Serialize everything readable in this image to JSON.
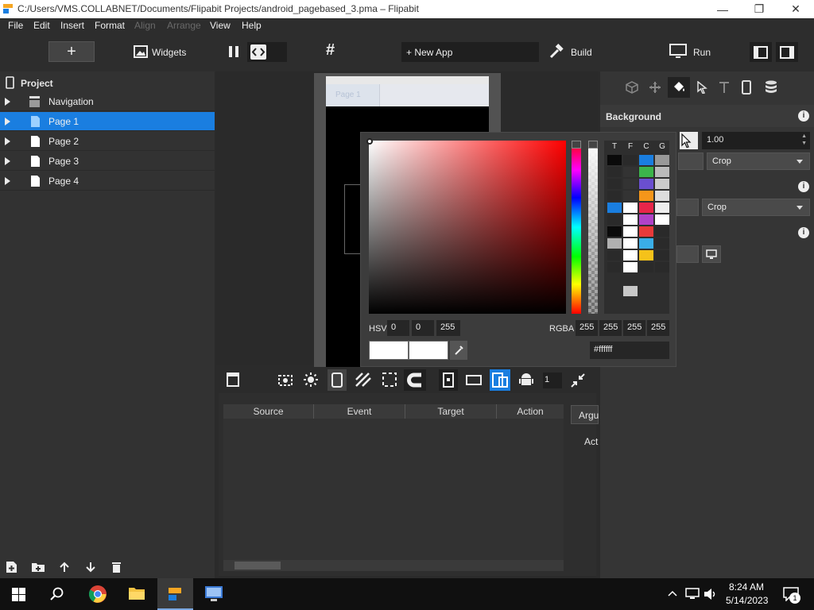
{
  "window": {
    "title": "C:/Users/VMS.COLLABNET/Documents/Flipabit Projects/android_pagebased_3.pma – Flipabit",
    "minimize_icon": "minimize-icon",
    "maximize_icon": "restore-icon",
    "close_icon": "close-icon"
  },
  "menu": {
    "file": "File",
    "edit": "Edit",
    "insert": "Insert",
    "format": "Format",
    "align": "Align",
    "arrange": "Arrange",
    "view": "View",
    "help": "Help"
  },
  "toolbar": {
    "add": "+",
    "widgets": "Widgets",
    "new_app": "+ New App",
    "build": "Build",
    "run": "Run"
  },
  "project": {
    "title": "Project",
    "items": [
      {
        "label": "Navigation",
        "icon": "navigation-icon",
        "selected": false
      },
      {
        "label": "Page 1",
        "icon": "page-icon",
        "selected": true
      },
      {
        "label": "Page 2",
        "icon": "page-icon",
        "selected": false
      },
      {
        "label": "Page 3",
        "icon": "page-icon",
        "selected": false
      },
      {
        "label": "Page 4",
        "icon": "page-icon",
        "selected": false
      }
    ]
  },
  "canvas": {
    "tab_label": "Page 1"
  },
  "properties": {
    "background_title": "Background",
    "opacity_value": "1.00",
    "crop_label_1": "Crop",
    "crop_label_2": "Crop"
  },
  "color_picker": {
    "hsv_label": "HSV",
    "hsv": [
      "0",
      "0",
      "255"
    ],
    "rgba_label": "RGBA",
    "rgba": [
      "255",
      "255",
      "255",
      "255"
    ],
    "hex": "#ffffff",
    "palette_headers": [
      "T",
      "F",
      "C",
      "G"
    ],
    "palette_colors": [
      [
        "#0a0a0a",
        "#2a2a2a",
        "#1a7ee0",
        "#999999"
      ],
      [
        "#2a2a2a",
        "#333333",
        "#3cb44b",
        "#bbbbbb"
      ],
      [
        "#2a2a2a",
        "#333333",
        "#6a4fd0",
        "#cccccc"
      ],
      [
        "#2a2a2a",
        "#333333",
        "#f5961a",
        "#dddddd"
      ],
      [
        "#1a7ee0",
        "#ffffff",
        "#e8264a",
        "#eeeeee"
      ],
      [
        "#2a2a2a",
        "#ffffff",
        "#b042c8",
        "#ffffff"
      ],
      [
        "#0a0a0a",
        "#ffffff",
        "#e83a3a",
        "#2a2a2a"
      ],
      [
        "#b0b0b0",
        "#ffffff",
        "#3aaee8",
        "#2a2a2a"
      ],
      [
        "#2a2a2a",
        "#ffffff",
        "#f5c21a",
        "#2a2a2a"
      ],
      [
        "#2a2a2a",
        "#ffffff",
        "#2a2a2a",
        "#2a2a2a"
      ]
    ]
  },
  "connections": {
    "columns": [
      "Source",
      "Event",
      "Target",
      "Action"
    ],
    "tab_arguments": "Argu",
    "action_label": "Act"
  },
  "page_zoom": "1",
  "taskbar": {
    "time": "8:24 AM",
    "date": "5/14/2023",
    "notification_count": "1"
  },
  "colors": {
    "accent": "#1a7ee0",
    "panel": "#323232",
    "toolbar": "#2d2d2d"
  }
}
